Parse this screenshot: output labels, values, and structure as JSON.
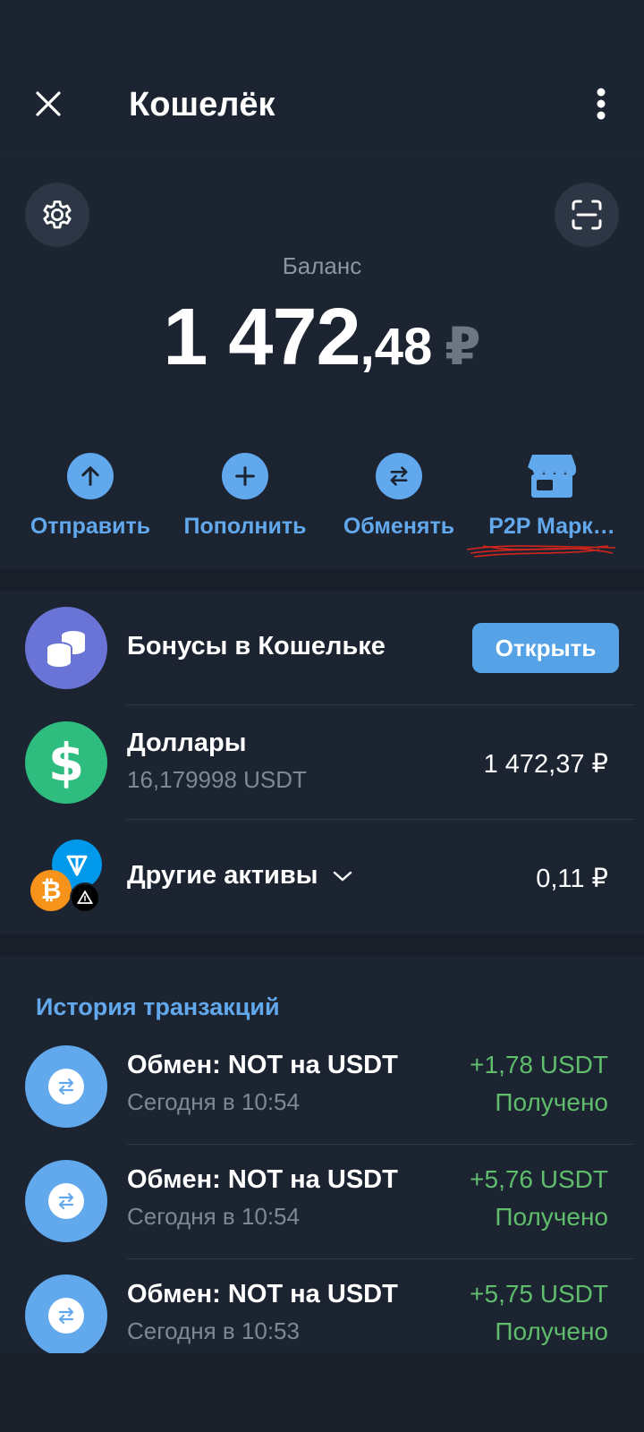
{
  "header": {
    "title": "Кошелёк"
  },
  "balance": {
    "label": "Баланс",
    "integer": "1 472",
    "decimal": ",48",
    "currency": "₽"
  },
  "actions": [
    {
      "label": "Отправить",
      "icon": "arrow-up-icon"
    },
    {
      "label": "Пополнить",
      "icon": "plus-icon"
    },
    {
      "label": "Обменять",
      "icon": "swap-icon"
    },
    {
      "label": "P2P Марк…",
      "icon": "store-icon"
    }
  ],
  "bonuses": {
    "title": "Бонусы в Кошельке",
    "button": "Открыть"
  },
  "assets": [
    {
      "title": "Доллары",
      "subtitle": "16,179998 USDT",
      "value": "1 472,37 ₽",
      "icon": "dollar-icon"
    },
    {
      "title": "Другие активы",
      "value": "0,11 ₽",
      "icon": "crypto-stack-icon"
    }
  ],
  "history": {
    "title": "История транзакций",
    "items": [
      {
        "title": "Обмен: NOT на USDT",
        "time": "Сегодня в 10:54",
        "amount": "+1,78 USDT",
        "status": "Получено"
      },
      {
        "title": "Обмен: NOT на USDT",
        "time": "Сегодня в 10:54",
        "amount": "+5,76 USDT",
        "status": "Получено"
      },
      {
        "title": "Обмен: NOT на USDT",
        "time": "Сегодня в 10:53",
        "amount": "+5,75 USDT",
        "status": "Получено"
      }
    ]
  },
  "colors": {
    "accent": "#62a8ec",
    "positive": "#5fbd6c",
    "background": "#181f29",
    "surface": "#1c2431"
  }
}
